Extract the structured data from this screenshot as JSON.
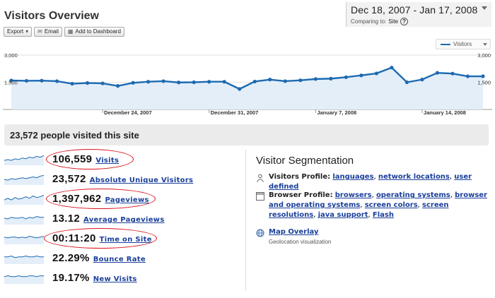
{
  "header": {
    "title": "Visitors Overview",
    "toolbar": [
      {
        "name": "export-button",
        "label": "Export",
        "icon": "chevron-down-icon"
      },
      {
        "name": "email-button",
        "label": "Email",
        "icon": "envelope-icon"
      },
      {
        "name": "add-to-dashboard-button",
        "label": "Add to Dashboard",
        "icon": "dashboard-icon"
      }
    ]
  },
  "date_picker": {
    "range": "Dec 18, 2007 - Jan 17, 2008",
    "comparing_label": "Comparing to:",
    "comparing_value": "Site",
    "help": "?"
  },
  "legend": {
    "label": "Visitors"
  },
  "chart_data": {
    "type": "area",
    "series": [
      {
        "name": "Visitors",
        "color": "#1d6ab0",
        "values": [
          1600,
          1580,
          1590,
          1560,
          1420,
          1460,
          1440,
          1300,
          1470,
          1530,
          1560,
          1490,
          1500,
          1530,
          1530,
          1130,
          1540,
          1650,
          1560,
          1610,
          1680,
          1700,
          1780,
          1880,
          1990,
          2310,
          1500,
          1650,
          2020,
          1980,
          1830,
          1830
        ]
      }
    ],
    "x": [
      "Dec 18",
      "Dec 19",
      "Dec 20",
      "Dec 21",
      "Dec 22",
      "Dec 23",
      "Dec 24",
      "Dec 25",
      "Dec 26",
      "Dec 27",
      "Dec 28",
      "Dec 29",
      "Dec 30",
      "Dec 31",
      "Jan 1",
      "Jan 2",
      "Jan 3",
      "Jan 4",
      "Jan 5",
      "Jan 6",
      "Jan 7",
      "Jan 8",
      "Jan 9",
      "Jan 10",
      "Jan 11",
      "Jan 12",
      "Jan 13",
      "Jan 14",
      "Jan 15",
      "Jan 16",
      "Jan 17"
    ],
    "ylim": [
      0,
      3000
    ],
    "y_ticks_left": [
      "3,000",
      "1,500"
    ],
    "y_ticks_right": [
      "3,000",
      "1,500"
    ],
    "x_tick_labels": [
      "December 24, 2007",
      "December 31, 2007",
      "January 7, 2008",
      "January 14, 2008"
    ],
    "grid": true
  },
  "summary": {
    "text": "23,572 people visited this site"
  },
  "metrics": [
    {
      "value": "106,559",
      "label": "Visits",
      "highlighted": true,
      "spark": [
        6,
        7,
        6,
        8,
        7,
        9,
        8,
        10,
        9,
        11,
        10,
        12
      ]
    },
    {
      "value": "23,572",
      "label": "Absolute Unique Visitors",
      "highlighted": false,
      "spark": [
        7,
        6,
        8,
        7,
        8,
        9,
        8,
        9,
        10,
        9,
        11,
        12
      ]
    },
    {
      "value": "1,397,962",
      "label": "Pageviews",
      "highlighted": true,
      "spark": [
        6,
        8,
        6,
        9,
        7,
        8,
        10,
        8,
        11,
        9,
        10,
        12
      ]
    },
    {
      "value": "13.12",
      "label": "Average Pageviews",
      "highlighted": false,
      "spark": [
        8,
        7,
        9,
        8,
        8,
        9,
        7,
        9,
        8,
        10,
        9,
        9
      ]
    },
    {
      "value": "00:11:20",
      "label": "Time on Site",
      "highlighted": true,
      "spark": [
        9,
        8,
        9,
        9,
        8,
        9,
        8,
        10,
        9,
        8,
        9,
        10
      ]
    },
    {
      "value": "22.29%",
      "label": "Bounce Rate",
      "highlighted": false,
      "spark": [
        9,
        9,
        10,
        8,
        9,
        9,
        10,
        9,
        9,
        10,
        9,
        9
      ]
    },
    {
      "value": "19.17%",
      "label": "New Visits",
      "highlighted": false,
      "spark": [
        9,
        10,
        9,
        9,
        10,
        9,
        9,
        10,
        10,
        9,
        10,
        10
      ]
    }
  ],
  "segmentation": {
    "title": "Visitor Segmentation",
    "visitors_profile": {
      "label": "Visitors Profile:",
      "links": [
        "languages",
        "network locations",
        "user defined"
      ]
    },
    "browser_profile": {
      "label": "Browser Profile:",
      "links": [
        "browsers",
        "operating systems",
        "browser and operating systems",
        "screen colors",
        "screen resolutions",
        "java support",
        "Flash"
      ]
    },
    "map_overlay": {
      "label": "Map Overlay",
      "sub": "Geolocation visualization"
    }
  },
  "colors": {
    "line": "#1d6ab0",
    "fill": "#e3eef9",
    "link": "#1a3f9a",
    "highlight": "#d8121b"
  }
}
